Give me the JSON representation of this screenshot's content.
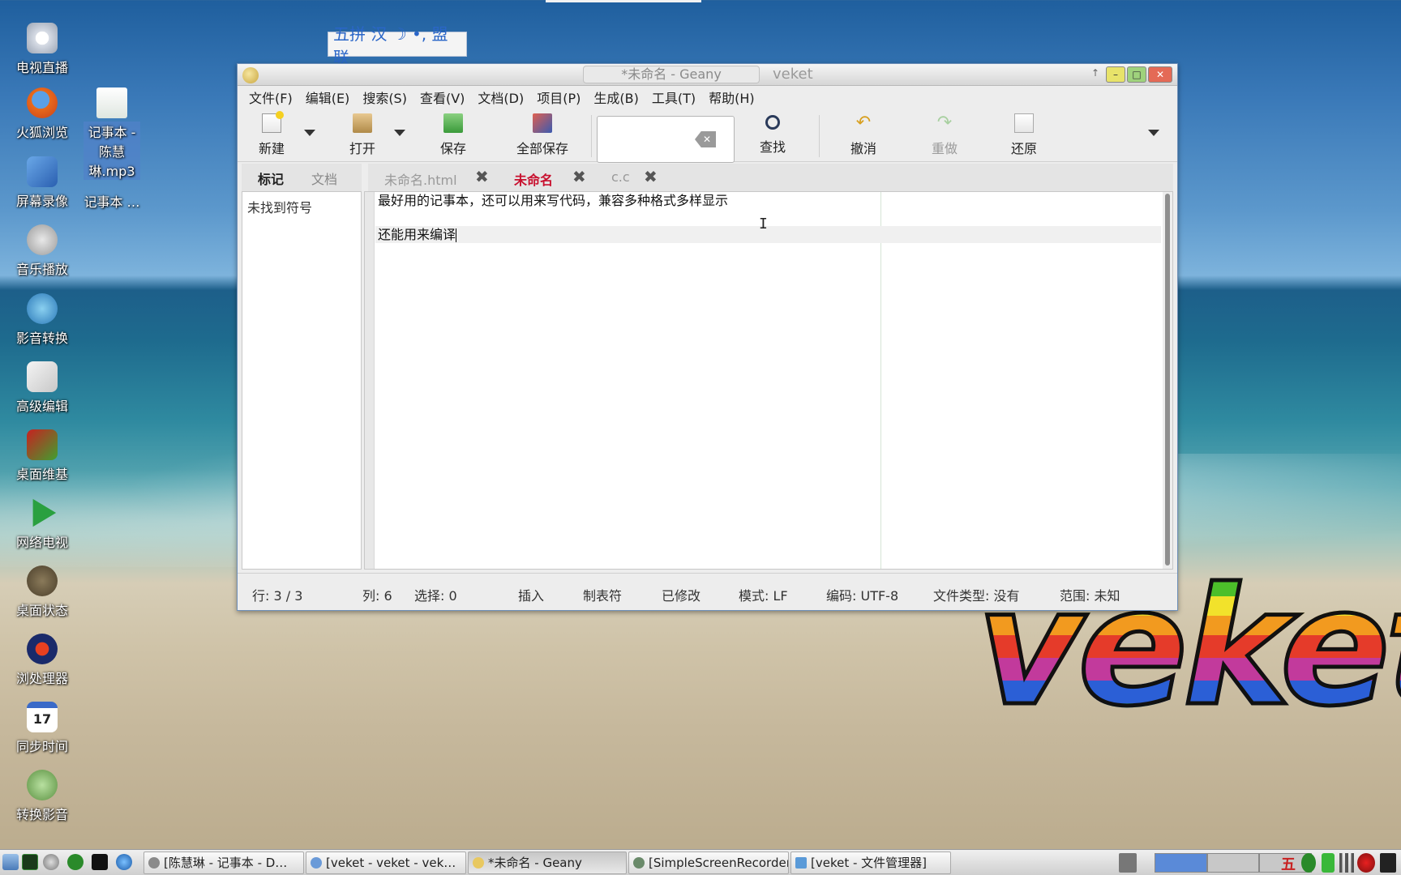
{
  "desktop": {
    "icons": [
      {
        "label": "电视直播"
      },
      {
        "label": "火狐浏览"
      },
      {
        "label": "屏幕录像"
      },
      {
        "label": "音乐播放"
      },
      {
        "label": "影音转换"
      },
      {
        "label": "高级编辑"
      },
      {
        "label": "桌面维基"
      },
      {
        "label": "网络电视"
      },
      {
        "label": "桌面状态"
      },
      {
        "label": "浏处理器"
      },
      {
        "label": "同步时间"
      },
      {
        "label": "转换影音"
      },
      {
        "label": "记事本 - 陈慧琳.mp3"
      },
      {
        "label": "记事本 …"
      }
    ],
    "calendar_day": "17",
    "logo_text": "veket"
  },
  "ime": {
    "text": "五拼 汉 ☽ •, 盟联"
  },
  "window": {
    "title": "*未命名 - Geany",
    "title_right": "veket",
    "menu": [
      "文件(F)",
      "编辑(E)",
      "搜索(S)",
      "查看(V)",
      "文档(D)",
      "项目(P)",
      "生成(B)",
      "工具(T)",
      "帮助(H)"
    ],
    "toolbar": {
      "new": "新建",
      "open": "打开",
      "save": "保存",
      "save_all": "全部保存",
      "search_value": "",
      "find": "查找",
      "undo": "撤消",
      "redo": "重做",
      "revert": "还原"
    },
    "side_tabs": [
      "标记",
      "文档"
    ],
    "side_panel_text": "未找到符号",
    "doc_tabs": [
      "未命名.html",
      "未命名",
      "c.c"
    ],
    "editor_lines": [
      "最好用的记事本，还可以用来写代码，兼容多种格式多样显示",
      "",
      "还能用来编译"
    ],
    "status": {
      "line": "行: 3 / 3",
      "col": "列: 6",
      "sel": "选择: 0",
      "insert": "插入",
      "tabs": "制表符",
      "modified": "已修改",
      "mode": "模式: LF",
      "encoding": "编码: UTF-8",
      "filetype": "文件类型: 没有",
      "scope": "范围: 未知"
    }
  },
  "taskbar": {
    "tasks": [
      "[陈慧琳 - 记事本 - D…",
      "[veket - veket - vek…",
      "*未命名 - Geany",
      "[SimpleScreenRecorder]",
      "[veket - 文件管理器]"
    ],
    "ime_indicator": "五"
  },
  "colors": {
    "active_tab": "#c8102e",
    "window_border": "#6e8fb8",
    "close_button": "#e46a56"
  }
}
